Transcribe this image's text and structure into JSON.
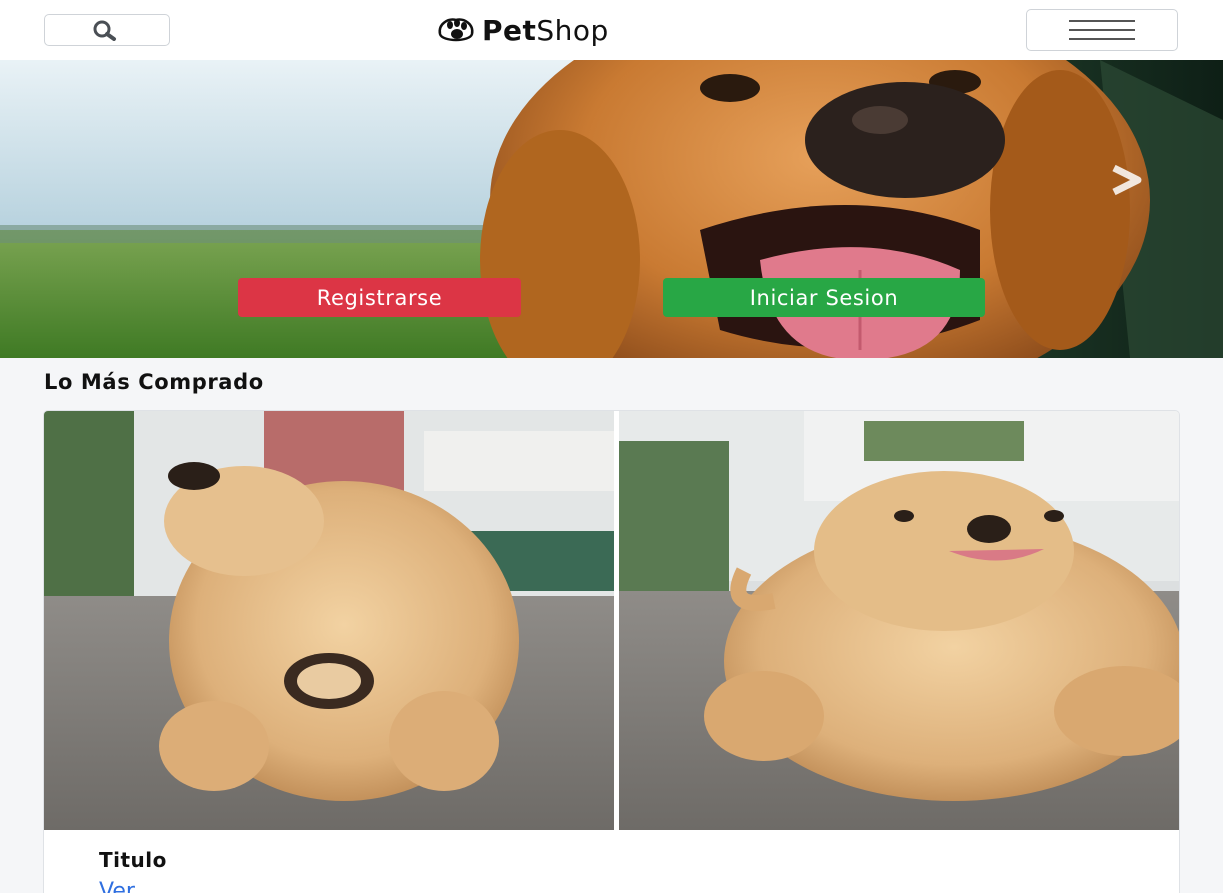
{
  "header": {
    "brand_bold": "Pet",
    "brand_light": "Shop"
  },
  "hero": {
    "register_label": "Registrarse",
    "login_label": "Iniciar Sesion"
  },
  "section": {
    "title": "Lo Más Comprado"
  },
  "card": {
    "title": "Titulo",
    "link": "Ver"
  },
  "colors": {
    "register": "#dc3545",
    "login": "#28a745",
    "link": "#2f6fe0"
  },
  "icons": {
    "search": "search-icon",
    "menu": "hamburger-menu-icon",
    "logo": "paw-icon",
    "next": "chevron-right-icon"
  }
}
